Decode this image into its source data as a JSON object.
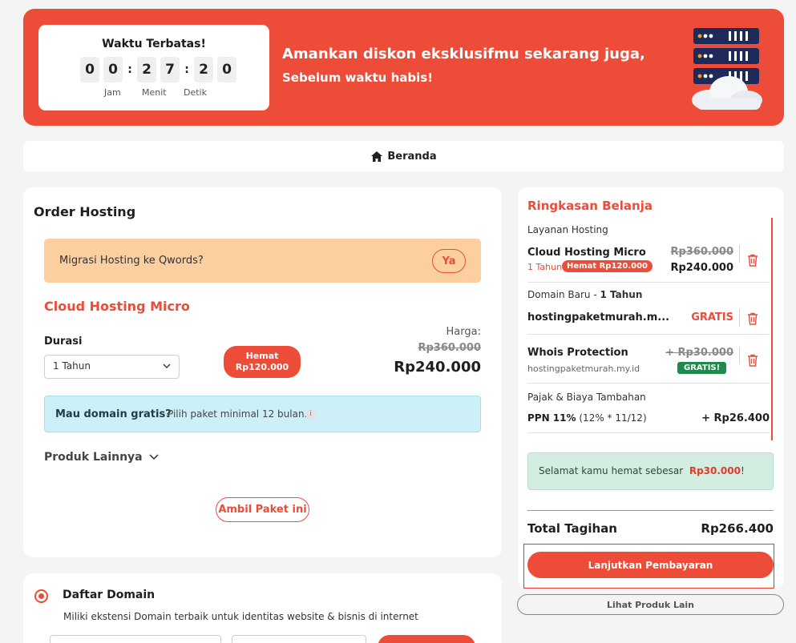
{
  "banner": {
    "timer_title": "Waktu Terbatas!",
    "digits": [
      "0",
      "0",
      "2",
      "7",
      "2",
      "0"
    ],
    "separator": ":",
    "units": {
      "hours": "Jam",
      "minutes": "Menit",
      "seconds": "Detik"
    },
    "headline": "Amankan diskon eksklusifmu sekarang juga,",
    "subline": "Sebelum waktu habis!",
    "color": "#ec4c38",
    "illustration_icon": "server-cloud-icon"
  },
  "nav": {
    "home_label": "Beranda",
    "home_icon": "home-icon"
  },
  "order": {
    "title": "Order Hosting",
    "migration_question": "Migrasi Hosting ke Qwords?",
    "migration_button": "Ya",
    "product_name": "Cloud Hosting Micro",
    "duration_label": "Durasi",
    "duration_value": "1 Tahun",
    "save_badge_line1": "Hemat",
    "save_badge_line2": "Rp120.000",
    "price_label": "Harga:",
    "price_old": "Rp360.000",
    "price_new": "Rp240.000",
    "free_domain_question": "Mau domain gratis?",
    "free_domain_hint": "Pilih paket minimal 12 bulan.",
    "info_icon_glyph": "i",
    "other_products": "Produk Lainnya",
    "take_package": "Ambil Paket ini"
  },
  "domain": {
    "title": "Daftar Domain",
    "description": "Miliki ekstensi Domain terbaik untuk identitas website & bisnis di internet"
  },
  "summary": {
    "title": "Ringkasan Belanja",
    "service_section": "Layanan Hosting",
    "service_name": "Cloud Hosting Micro",
    "service_duration": "1 Tahun",
    "service_save_tag": "Hemat Rp120.000",
    "service_price_old": "Rp360.000",
    "service_price_new": "Rp240.000",
    "domain_section_prefix": "Domain Baru - ",
    "domain_section_duration": "1 Tahun",
    "domain_name": "hostingpaketmurah.m...",
    "domain_price": "GRATIS",
    "whois_name": "Whois Protection",
    "whois_domain": "hostingpaketmurah.my.id",
    "whois_price_old": "+ Rp30.000",
    "whois_free_tag": "GRATIS!",
    "tax_section": "Pajak & Biaya Tambahan",
    "tax_name": "PPN 11%",
    "tax_formula": "(12% * 11/12)",
    "tax_value": "+ Rp26.400",
    "savings_text": "Selamat kamu hemat sebesar",
    "savings_amount": "Rp30.000",
    "savings_suffix": "!",
    "total_label": "Total Tagihan",
    "total_value": "Rp266.400",
    "pay_button": "Lanjutkan Pembayaran",
    "other_products_button": "Lihat Produk Lain"
  }
}
